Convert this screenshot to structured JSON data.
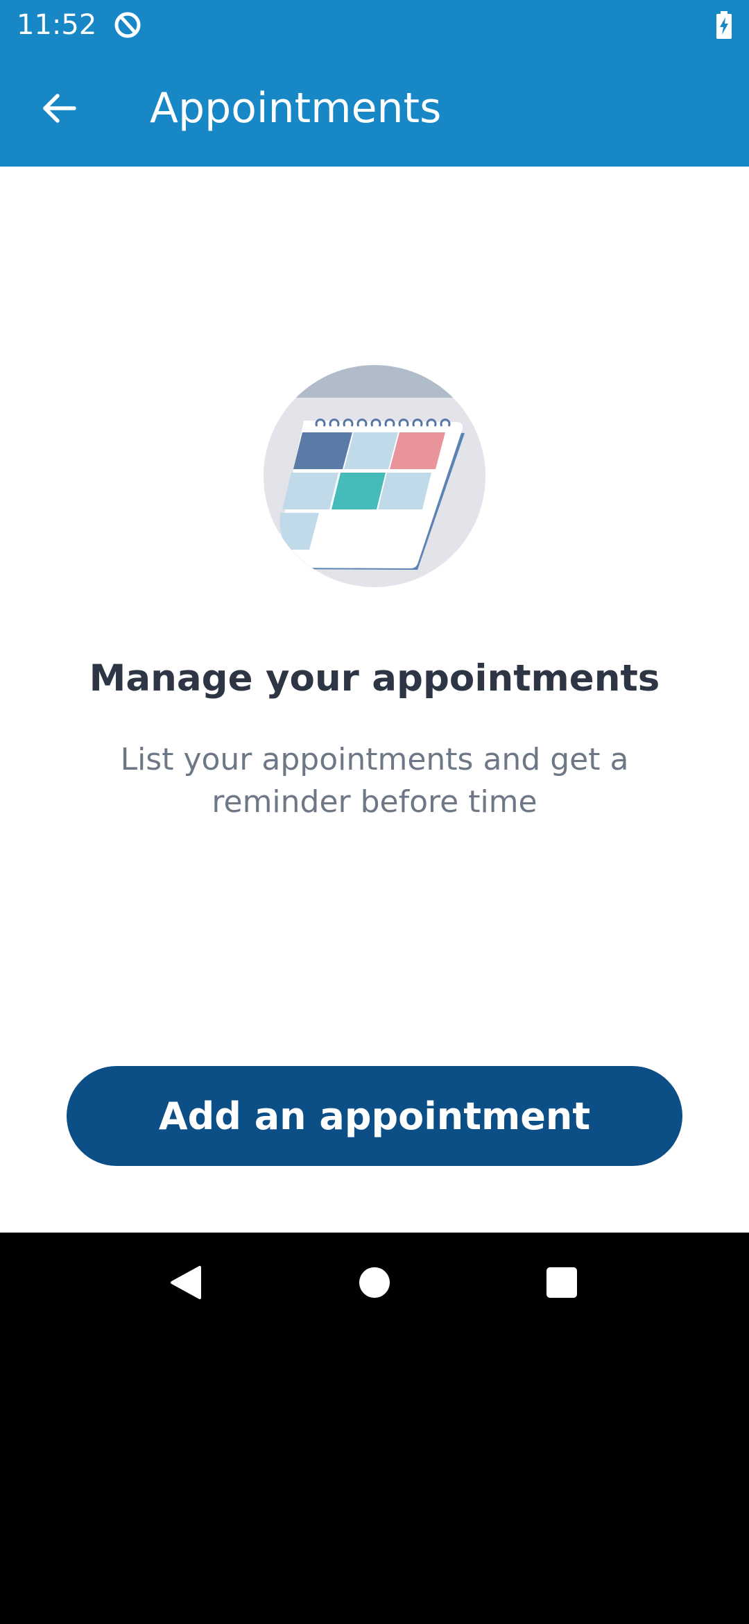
{
  "status_bar": {
    "time": "11:52",
    "icons": [
      "app-notification-icon",
      "battery-charging-icon"
    ]
  },
  "app_bar": {
    "title": "Appointments",
    "back_icon": "arrow-back-icon",
    "background_color": "#1787c6"
  },
  "empty_state": {
    "illustration": "calendar-illustration",
    "heading": "Manage your appointments",
    "description": "List your appointments and get a reminder before time"
  },
  "actions": {
    "add_label": "Add an appointment",
    "button_color": "#0c4f86"
  },
  "navigation_bar": {
    "buttons": [
      "back-triangle-icon",
      "home-circle-icon",
      "recents-square-icon"
    ]
  }
}
